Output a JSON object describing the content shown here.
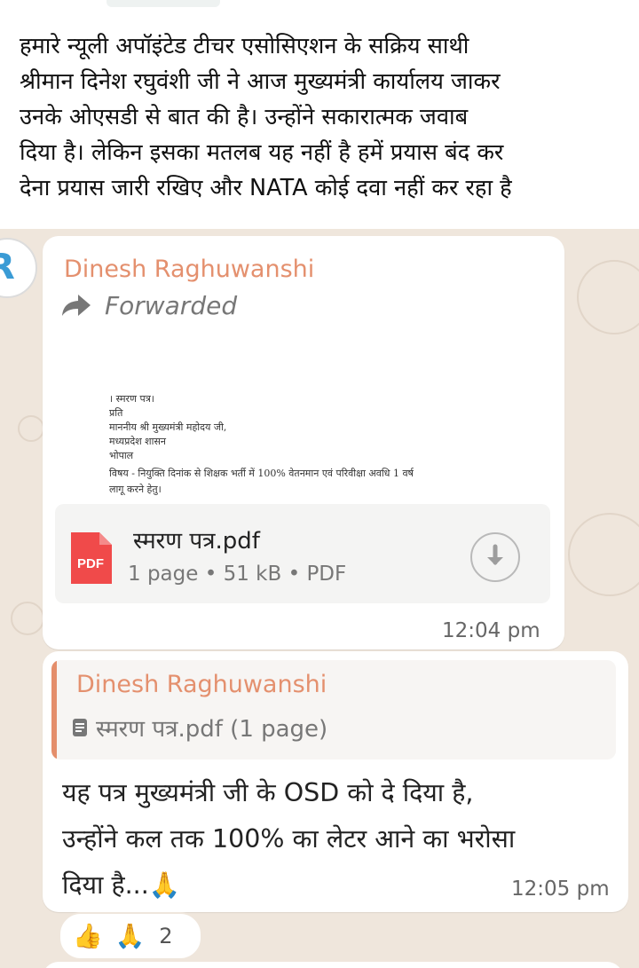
{
  "caption": {
    "lines": [
      "हमारे न्यूली अपॉइंटेड टीचर एसोसिएशन के सक्रिय साथी",
      "श्रीमान दिनेश रघुवंशी जी ने आज मुख्यमंत्री कार्यालय जाकर",
      "उनके ओएसडी से बात की है। उन्होंने सकारात्मक जवाब",
      "दिया है। लेकिन इसका मतलब यह नहीं है हमें प्रयास बंद कर",
      "देना प्रयास जारी रखिए और NATA कोई दवा नहीं कर रहा है"
    ]
  },
  "message1": {
    "sender": "Dinesh Raghuwanshi",
    "forwarded_label": "Forwarded",
    "forward_icon": "forward-arrow-icon",
    "document_preview": {
      "lines": [
        "। स्मरण पत्र।",
        "प्रति",
        "माननीय श्री मुख्यमंत्री महोदय जी,",
        "मध्यप्रदेश शासन",
        "भोपाल",
        "विषय - नियुक्ति दिनांक से शिक्षक भर्ती में 100% वेतनमान एवं परिवीक्षा अवधि 1 वर्ष",
        "लागू करने हेतु।"
      ]
    },
    "file": {
      "icon_label": "PDF",
      "name": "स्मरण पत्र.pdf",
      "meta": "1 page • 51 kB • PDF",
      "download_icon": "download-icon"
    },
    "time": "12:04 pm"
  },
  "message2": {
    "quote": {
      "sender": "Dinesh Raghuwanshi",
      "file_label": "स्मरण पत्र.pdf (1 page)",
      "file_icon": "document-icon"
    },
    "text_lines": [
      "यह पत्र मुख्यमंत्री जी के OSD को दे दिया है,",
      "उन्होंने कल तक 100% का लेटर आने का भरोसा",
      "दिया है...🙏"
    ],
    "time": "12:05 pm",
    "reactions": {
      "emojis": [
        "👍",
        "🙏"
      ],
      "count": "2"
    }
  },
  "colors": {
    "sender": "#e4906e",
    "chat_background": "#efe6dc",
    "pdf_red": "#f04a4a"
  }
}
